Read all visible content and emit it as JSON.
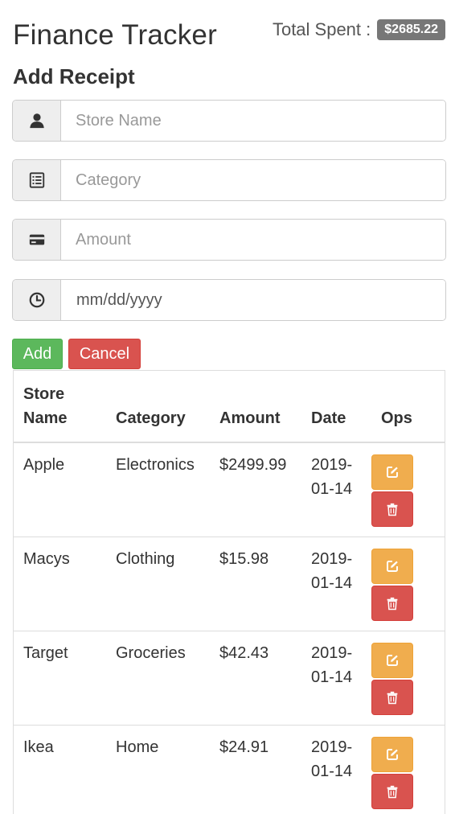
{
  "app": {
    "title": "Finance Tracker",
    "total_label": "Total Spent :",
    "total_value": "$2685.22"
  },
  "form": {
    "heading": "Add Receipt",
    "store_placeholder": "Store Name",
    "category_placeholder": "Category",
    "amount_placeholder": "Amount",
    "date_value": "mm/dd/yyyy",
    "add_label": "Add",
    "cancel_label": "Cancel"
  },
  "table": {
    "headers": {
      "store": "Store Name",
      "category": "Category",
      "amount": "Amount",
      "date": "Date",
      "ops": "Ops"
    },
    "rows": [
      {
        "store": "Apple",
        "category": "Electronics",
        "amount": "$2499.99",
        "date": "2019-01-14"
      },
      {
        "store": "Macys",
        "category": "Clothing",
        "amount": "$15.98",
        "date": "2019-01-14"
      },
      {
        "store": "Target",
        "category": "Groceries",
        "amount": "$42.43",
        "date": "2019-01-14"
      },
      {
        "store": "Ikea",
        "category": "Home",
        "amount": "$24.91",
        "date": "2019-01-14"
      }
    ]
  },
  "icons": {
    "store": "user-icon",
    "category": "list-icon",
    "amount": "credit-card-icon",
    "date": "clock-icon",
    "edit": "edit-icon",
    "delete": "trash-icon"
  },
  "colors": {
    "add": "#5cb85c",
    "cancel": "#d9534f",
    "edit": "#f0ad4e",
    "delete": "#d9534f",
    "badge": "#777777"
  }
}
